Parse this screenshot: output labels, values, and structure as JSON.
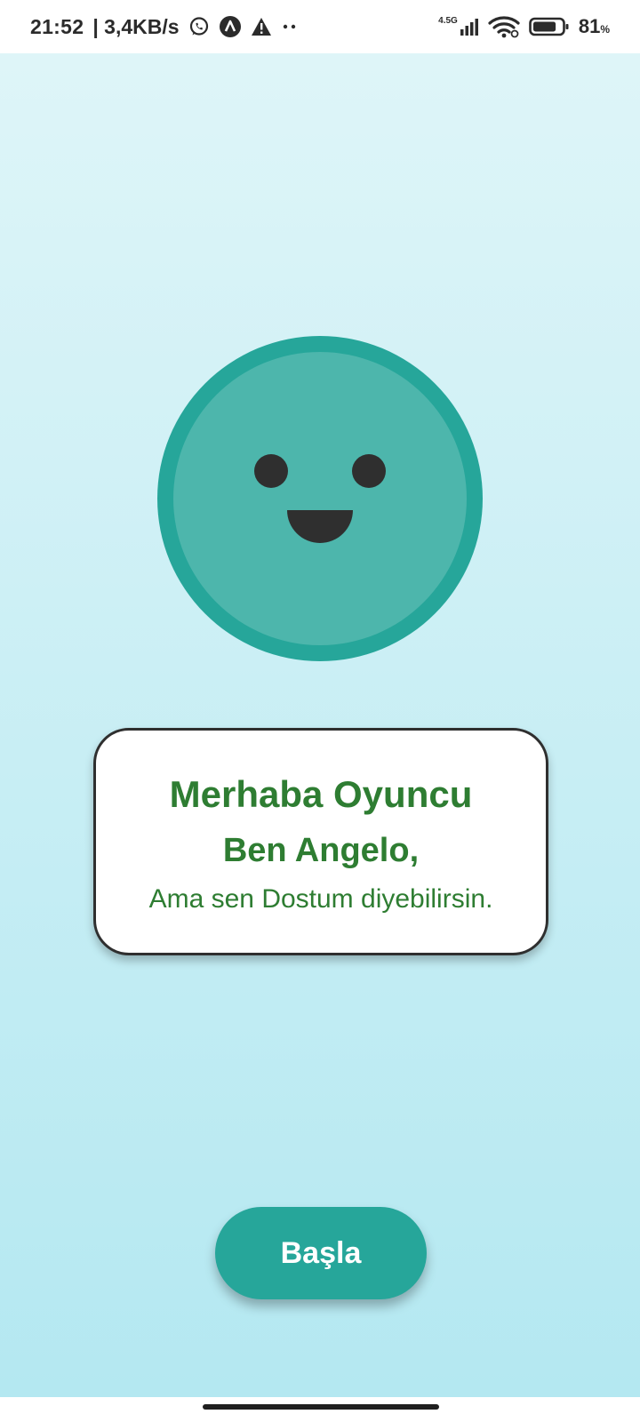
{
  "status_bar": {
    "time": "21:52",
    "speed": "| 3,4KB/s",
    "network_type": "4.5G",
    "battery_percent": "81",
    "battery_unit": "%",
    "battery_level": 0.81,
    "icons": [
      "whatsapp-icon",
      "app-a-icon",
      "warning-icon",
      "more-dots-icon",
      "signal-icon",
      "wifi-icon",
      "battery-icon"
    ]
  },
  "character": {
    "face_color": "#4db6ac",
    "ring_color": "#26a69a",
    "feature_color": "#2f2f2f"
  },
  "dialog": {
    "greeting": "Merhaba Oyuncu",
    "intro": "Ben Angelo,",
    "subtitle": "Ama sen Dostum diyebilirsin.",
    "text_color": "#2e7d32"
  },
  "actions": {
    "start_label": "Başla",
    "button_color": "#26a69a"
  }
}
